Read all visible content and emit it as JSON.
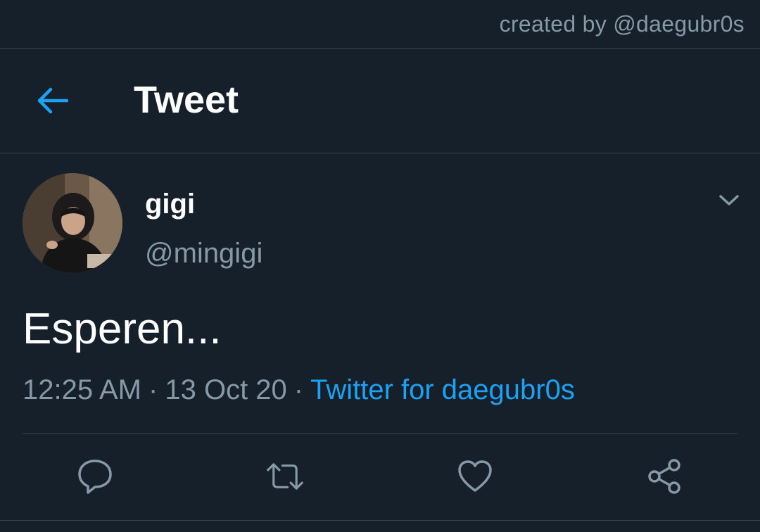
{
  "credit": {
    "text": "created by @daegubr0s"
  },
  "header": {
    "back_icon": "arrow-left-icon",
    "title": "Tweet"
  },
  "tweet": {
    "author": {
      "display_name": "gigi",
      "handle": "@mingigi",
      "avatar_icon": "profile-photo"
    },
    "menu_icon": "chevron-down-icon",
    "text": "Esperen...",
    "time": "12:25 AM",
    "separator": "·",
    "date": "13 Oct 20",
    "source": "Twitter for daegubr0s"
  },
  "actions": {
    "reply_icon": "reply-icon",
    "retweet_icon": "retweet-icon",
    "like_icon": "heart-icon",
    "share_icon": "share-icon"
  },
  "colors": {
    "background": "#15202b",
    "accent": "#1da1f2",
    "muted_text": "#8899a6",
    "divider": "#38444d",
    "primary_text": "#ffffff"
  }
}
